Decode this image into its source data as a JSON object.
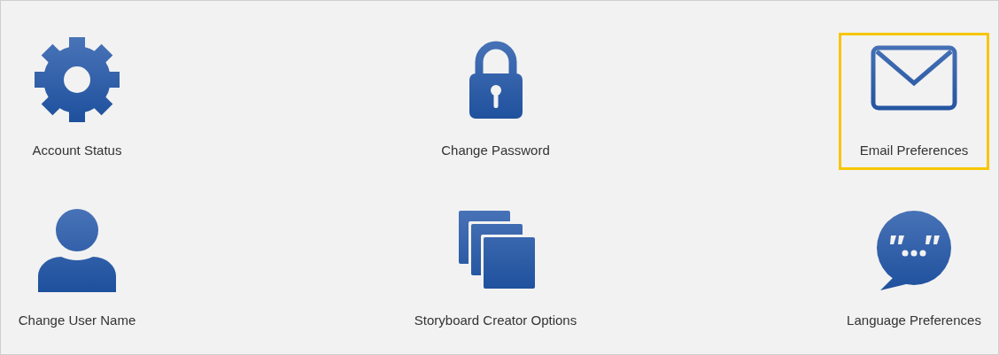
{
  "tiles": [
    {
      "label": "Account Status",
      "selected": false
    },
    {
      "label": "Change Password",
      "selected": false
    },
    {
      "label": "Email Preferences",
      "selected": true
    },
    {
      "label": "Change User Name",
      "selected": false
    },
    {
      "label": "Storyboard Creator Options",
      "selected": false
    },
    {
      "label": "Language Preferences",
      "selected": false
    }
  ]
}
